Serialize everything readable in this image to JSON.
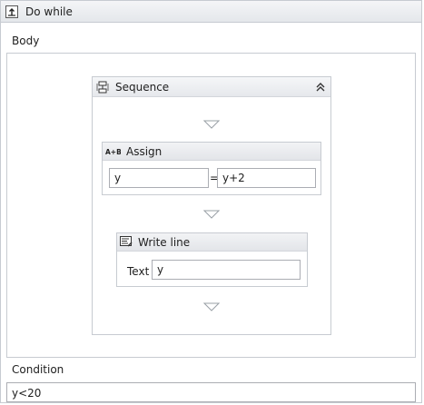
{
  "activity": {
    "title": "Do while",
    "icon": "do-while-icon"
  },
  "body": {
    "label": "Body",
    "sequence": {
      "title": "Sequence",
      "icon": "sequence-icon",
      "collapse_icon": "collapse-chevrons-icon",
      "assign": {
        "title": "Assign",
        "icon": "assign-icon",
        "to": "y",
        "equals": "=",
        "value": "y+2"
      },
      "write_line": {
        "title": "Write line",
        "icon": "write-line-icon",
        "text_label": "Text",
        "text_value": "y"
      }
    }
  },
  "condition": {
    "label": "Condition",
    "value": "y<20"
  }
}
